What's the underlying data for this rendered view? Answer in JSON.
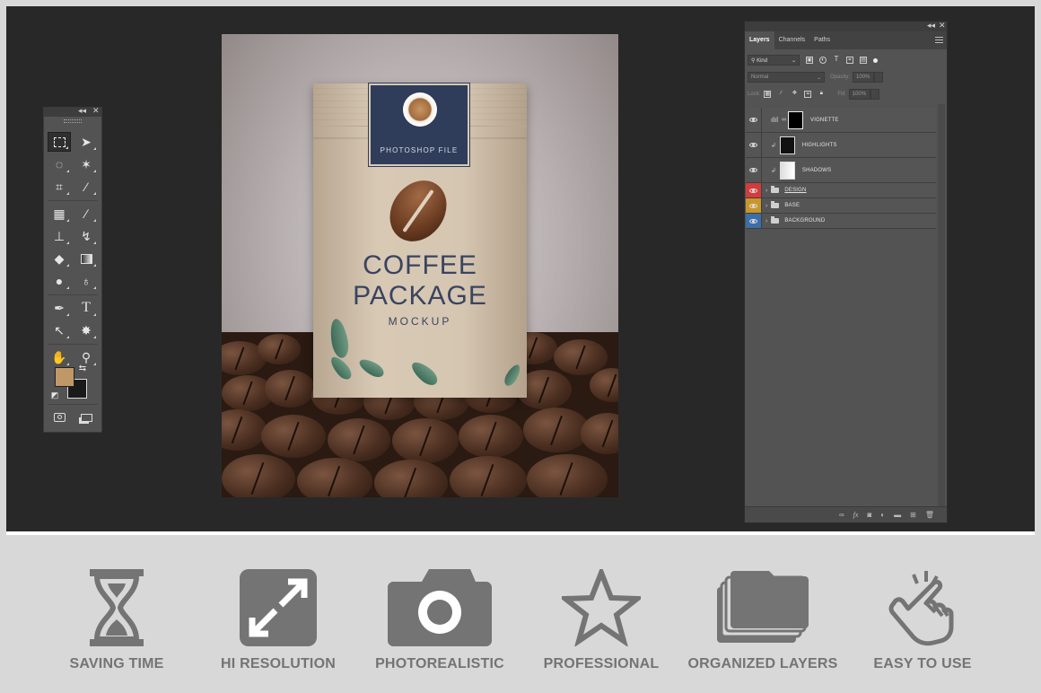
{
  "toolbox": {
    "header_collapse": "◂◂",
    "header_close": "✕",
    "foreground_color": "#c09868",
    "background_color": "#1a1a1a"
  },
  "canvas": {
    "label_text": "PHOTOSHOP FILE",
    "title_line1": "COFFEE",
    "title_line2": "PACKAGE",
    "title_line3": "MOCKUP"
  },
  "layers_panel": {
    "collapse": "◂◂",
    "close": "✕",
    "tabs": [
      {
        "label": "Layers",
        "active": true
      },
      {
        "label": "Channels",
        "active": false
      },
      {
        "label": "Paths",
        "active": false
      }
    ],
    "filter": {
      "label": "Kind"
    },
    "blend_mode": "Normal",
    "opacity_label": "Opacity:",
    "opacity_value": "100%",
    "lock_label": "Lock:",
    "fill_label": "Fill:",
    "fill_value": "100%",
    "layers": [
      {
        "name": "VIGNETTE",
        "eye_color": "",
        "type": "adjustment"
      },
      {
        "name": "HIGHLIGHTS",
        "eye_color": "",
        "type": "clipped"
      },
      {
        "name": "SHADOWS",
        "eye_color": "",
        "type": "clipped"
      },
      {
        "name": "DESIGN",
        "eye_color": "#d23c3c",
        "type": "group"
      },
      {
        "name": "BASE",
        "eye_color": "#c8962a",
        "type": "group"
      },
      {
        "name": "BACKGROUND",
        "eye_color": "#3c6ea8",
        "type": "group"
      }
    ],
    "footer_icons": [
      "link-icon",
      "fx-icon",
      "mask-icon",
      "adjustment-icon",
      "folder-icon",
      "new-layer-icon",
      "trash-icon"
    ]
  },
  "features": [
    {
      "label": "SAVING TIME",
      "icon": "hourglass-icon"
    },
    {
      "label": "HI RESOLUTION",
      "icon": "expand-icon"
    },
    {
      "label": "PHOTOREALISTIC",
      "icon": "camera-icon"
    },
    {
      "label": "PROFESSIONAL",
      "icon": "star-icon"
    },
    {
      "label": "ORGANIZED LAYERS",
      "icon": "stacked-layers-icon"
    },
    {
      "label": "EASY TO USE",
      "icon": "pointing-hand-icon"
    }
  ],
  "icon_color": "#747474"
}
